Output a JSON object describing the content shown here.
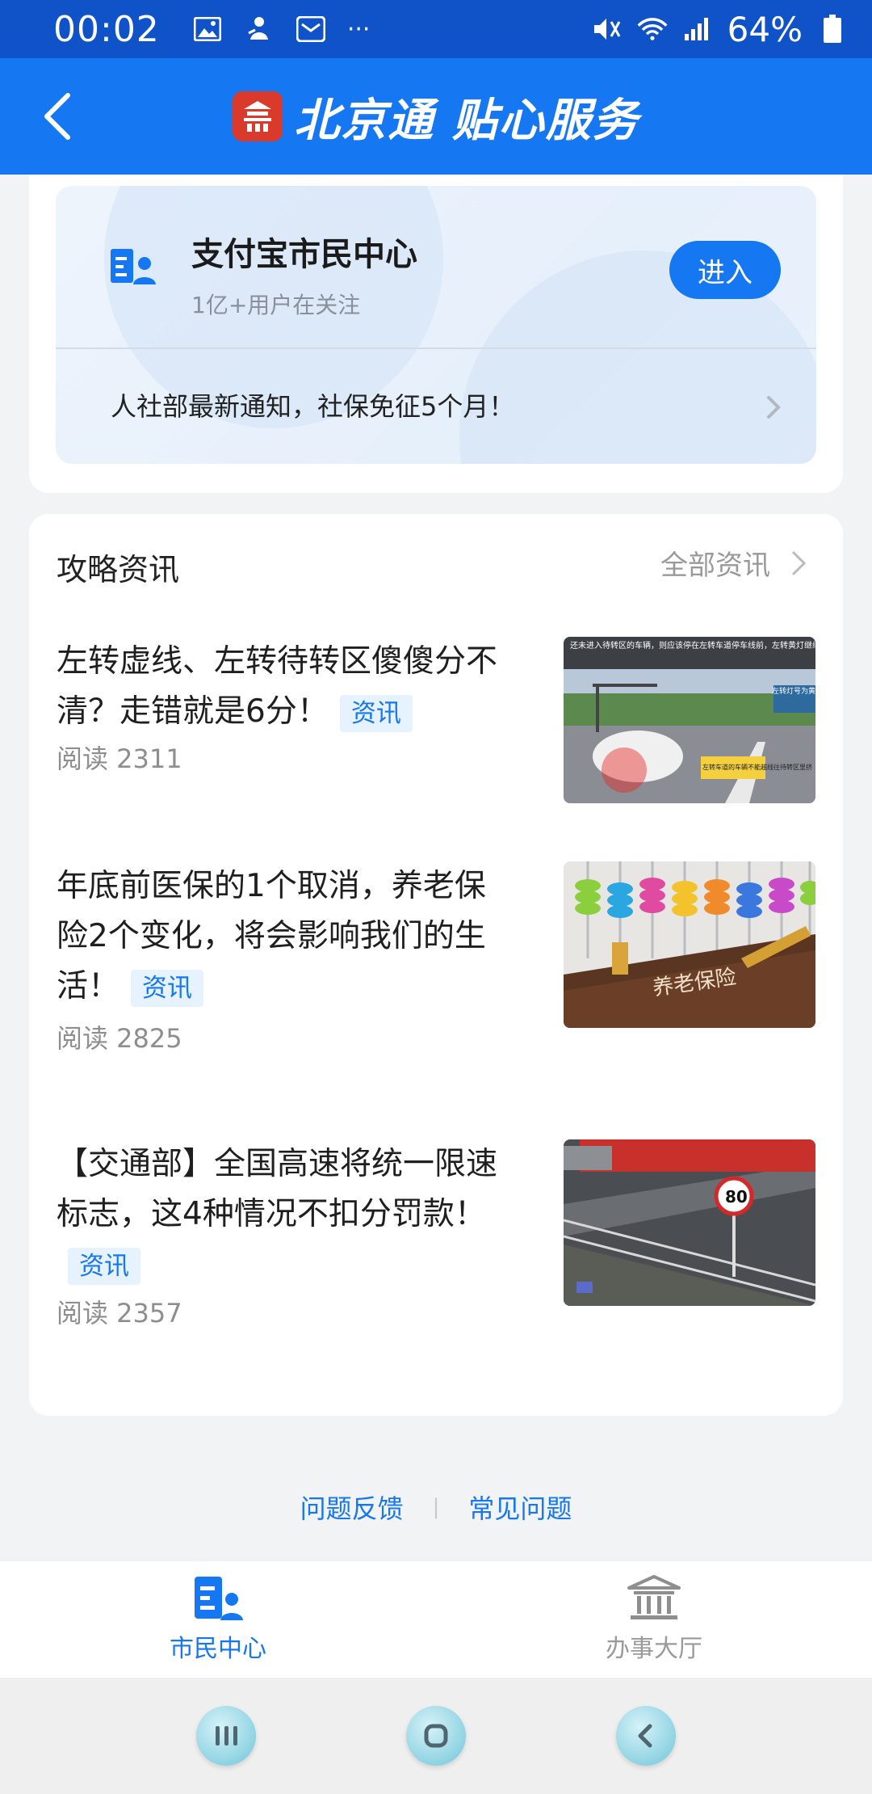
{
  "status_bar": {
    "time": "00:02",
    "battery": "64%",
    "more": "···"
  },
  "header": {
    "brand": "北京通 贴心服务"
  },
  "mini_center": {
    "title": "支付宝市民中心",
    "subtitle": "1亿+用户在关注",
    "enter_label": "进入",
    "notice": "人社部最新通知，社保免征5个月！"
  },
  "news": {
    "section_title": "攻略资讯",
    "more_label": "全部资讯",
    "tag_label": "资讯",
    "items": [
      {
        "title": "左转虚线、左转待转区傻傻分不清？走错就是6分！",
        "tag": "资讯",
        "read": "阅读 2311",
        "thumb_caption_top": "还未进入待转区的车辆，则应该停在左转车道停车线前，左转黄灯继续往待转区里挤，否则容易与另一方向的直行",
        "thumb_caption_sign": "左转灯号为黄",
        "thumb_caption_box": "左转车道的车辆不能越线往待转区里挤"
      },
      {
        "title": "年底前医保的1个取消，养老保险2个变化，将会影响我们的生活！",
        "tag": "资讯",
        "read": "阅读 2825",
        "thumb_caption": "养老保险"
      },
      {
        "title": "【交通部】全国高速将统一限速标志，这4种情况不扣分罚款！",
        "tag": "资讯",
        "read": "阅读 2357",
        "thumb_sign": "80"
      }
    ]
  },
  "footer": {
    "feedback": "问题反馈",
    "separator": "|",
    "faq": "常见问题"
  },
  "tabs": [
    {
      "label": "市民中心",
      "active": true
    },
    {
      "label": "办事大厅",
      "active": false
    }
  ],
  "colors": {
    "status_bar": "#1052c8",
    "header": "#1677f2",
    "accent": "#1677f2",
    "logo_red": "#d93a2b"
  }
}
